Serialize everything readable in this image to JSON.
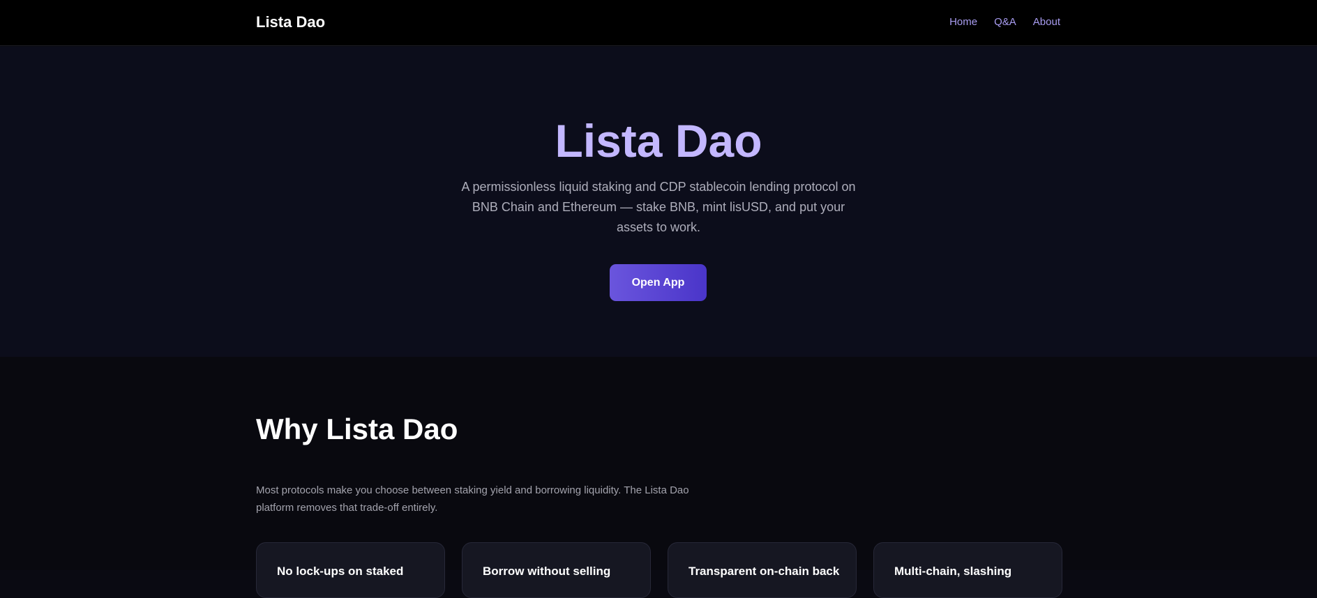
{
  "header": {
    "brand": "Lista Dao",
    "nav": [
      "Home",
      "Q&A",
      "About"
    ]
  },
  "hero": {
    "title": "Lista Dao",
    "subtitle": "A permissionless liquid staking and CDP stablecoin lending protocol on BNB Chain and Ethereum — stake BNB, mint lisUSD, and put your assets to work.",
    "cta_label": "Open App"
  },
  "why": {
    "title": "Why Lista Dao",
    "description": "Most protocols make you choose between staking yield and borrowing liquidity. The Lista Dao platform removes that trade-off entirely.",
    "cards": [
      {
        "title": "No lock-ups on staked"
      },
      {
        "title": "Borrow without selling"
      },
      {
        "title": "Transparent on-chain back"
      },
      {
        "title": "Multi-chain, slashing"
      }
    ]
  },
  "colors": {
    "accent": "#c3b7ff",
    "nav_link": "#a89cf0",
    "button_start": "#6a55dd",
    "button_end": "#4a35c9"
  }
}
